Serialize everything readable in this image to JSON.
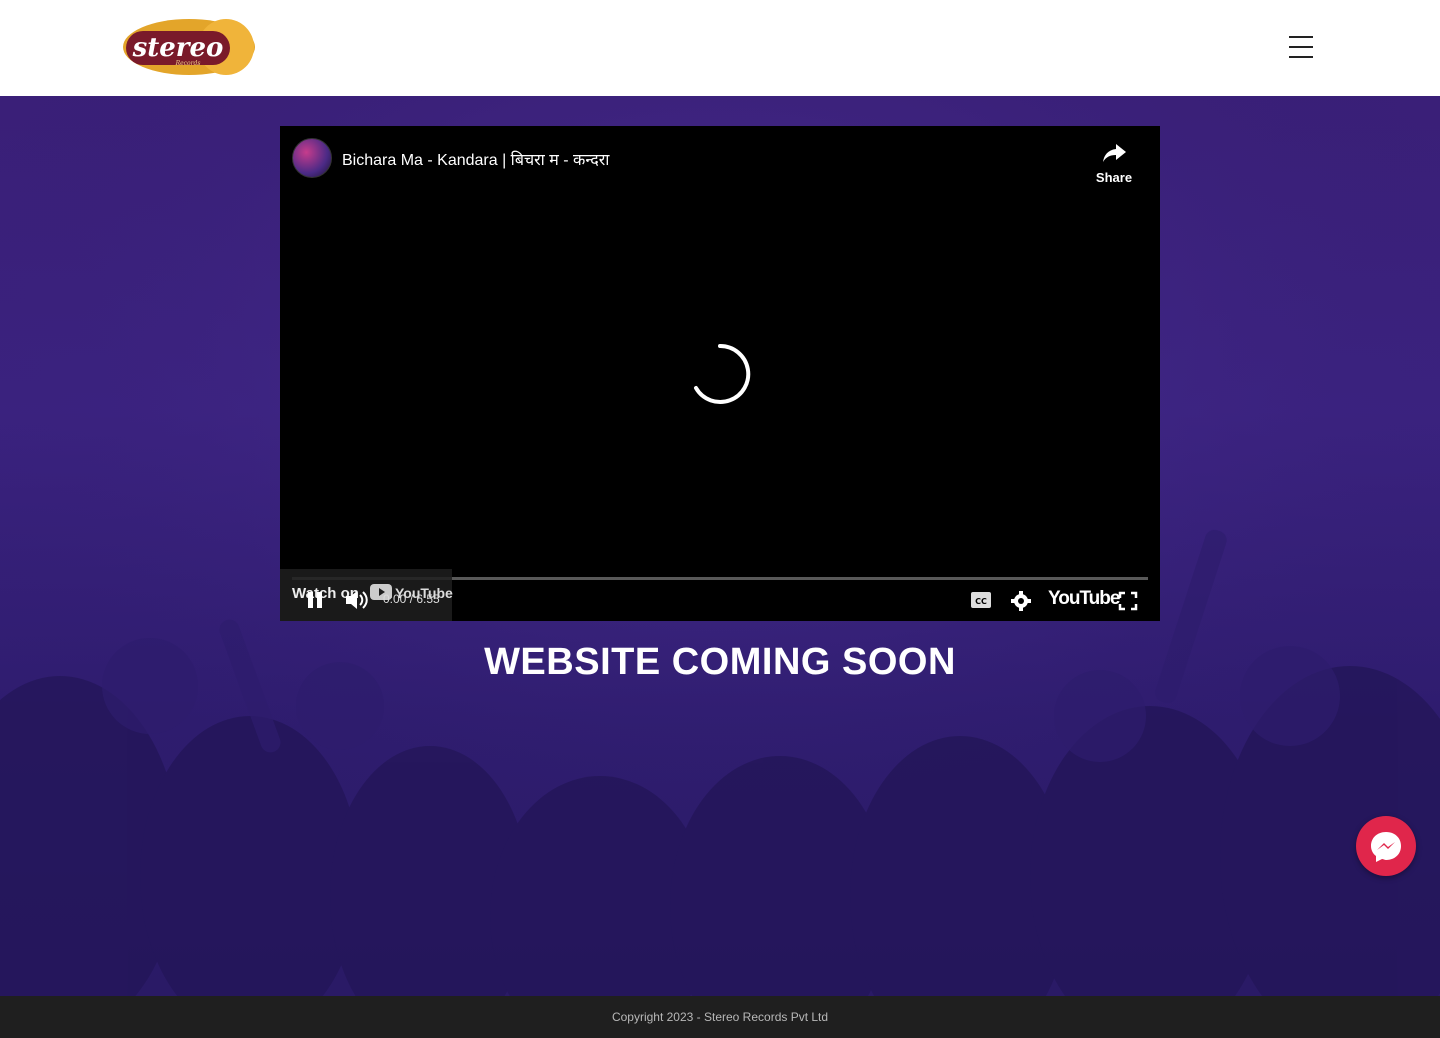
{
  "header": {
    "logo_text": "stereo",
    "logo_subtext": "Records",
    "menu_icon": "hamburger-menu-icon"
  },
  "video": {
    "title": "Bichara Ma - Kandara | बिचरा म - कन्दरा",
    "share_label": "Share",
    "watch_on_label": "Watch on",
    "youtube_label": "YouTube",
    "current_time": "0:00",
    "duration": "6:55",
    "time_display": "0:00 / 6:55",
    "cc_label": "CC",
    "icons": [
      "share-icon",
      "pause-icon",
      "volume-icon",
      "captions-icon",
      "settings-icon",
      "youtube-logo-icon",
      "fullscreen-icon",
      "loading-spinner-icon"
    ]
  },
  "hero": {
    "heading": "WEBSITE COMING SOON"
  },
  "messenger": {
    "icon": "messenger-icon",
    "color": "#e0264b"
  },
  "footer": {
    "copyright": "Copyright 2023 - Stereo Records Pvt Ltd"
  },
  "colors": {
    "hero_bg": "#3a1f78",
    "footer_bg": "#1f1f1f",
    "logo_gold": "#e3a52a",
    "logo_maroon": "#7a1a2a"
  }
}
